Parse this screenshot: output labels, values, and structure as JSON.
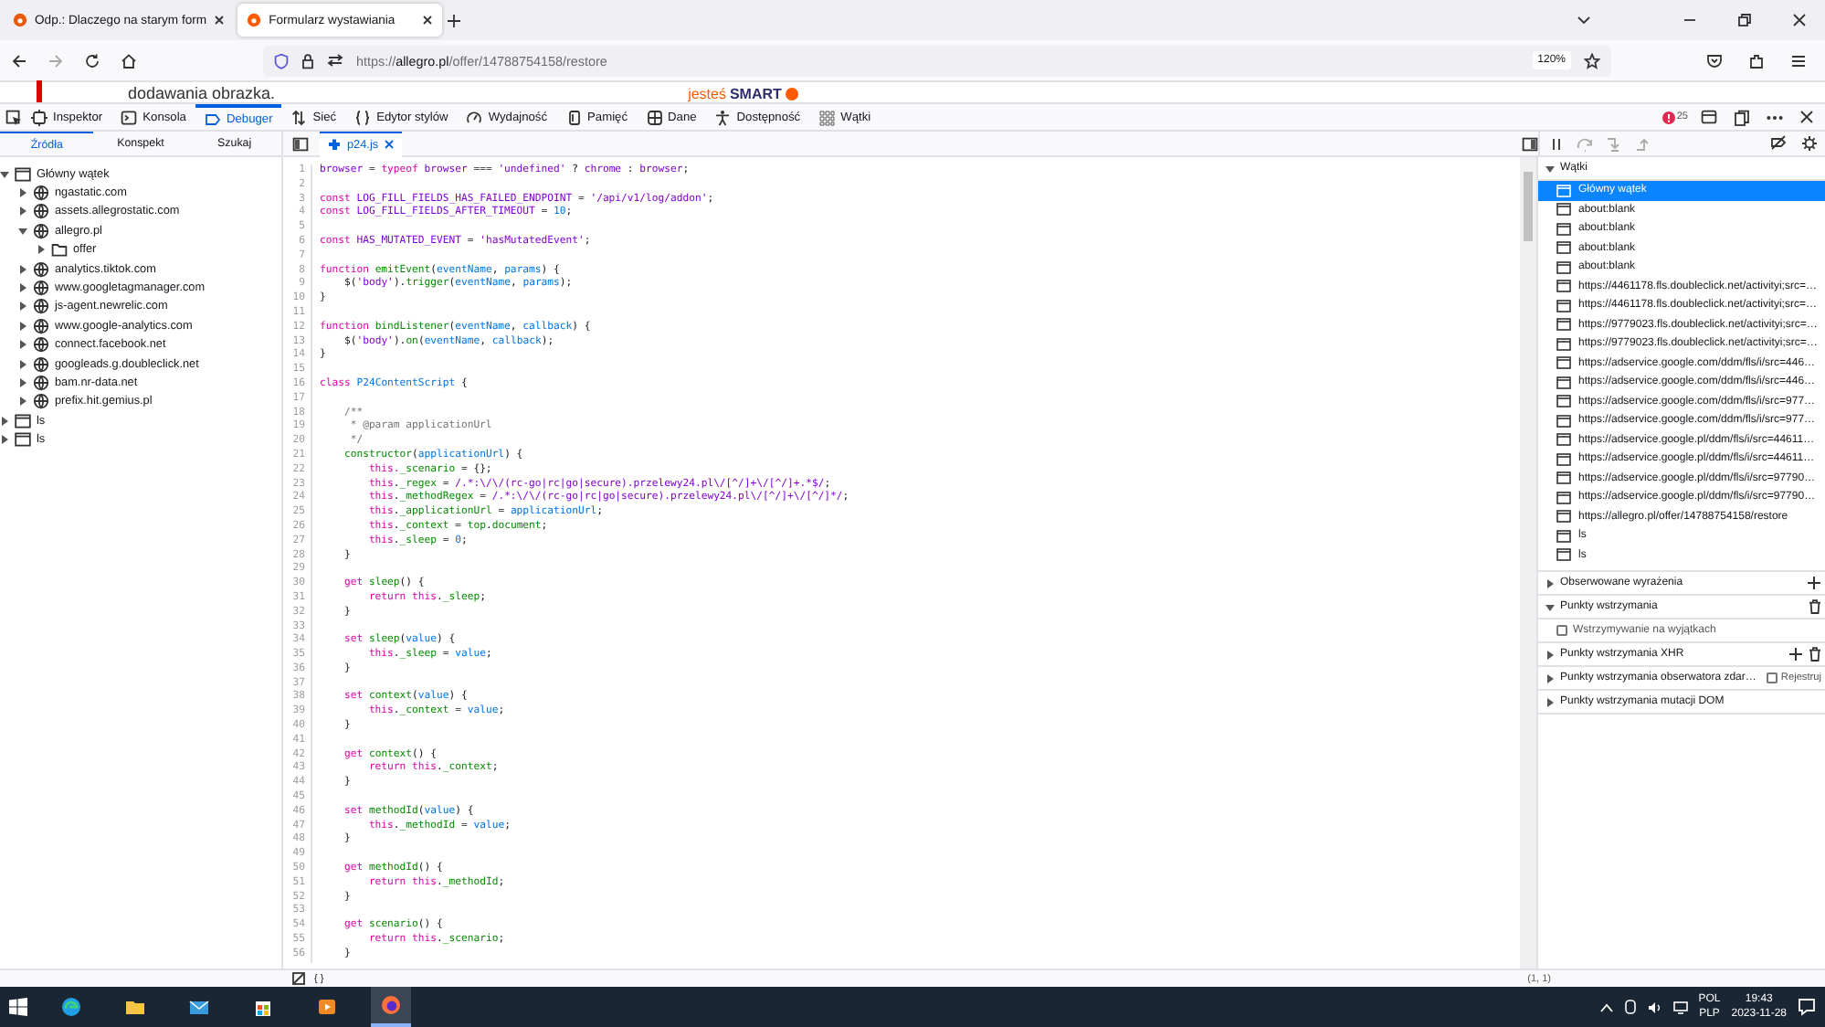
{
  "browser_tabs": [
    {
      "title": "Odp.: Dlaczego na starym form",
      "selected": false
    },
    {
      "title": "Formularz wystawiania",
      "selected": true
    }
  ],
  "address_bar": {
    "url": "https://**allegro.pl**/offer/14788754158/restore",
    "zoom": "120%"
  },
  "page": {
    "text": "dodawania obrazka.",
    "banner_prefix": "jesteś",
    "banner_brand": "SMART"
  },
  "devtools": {
    "tools": [
      {
        "label": "Inspektor",
        "kind": "inspector",
        "selected": false
      },
      {
        "label": "Konsola",
        "kind": "console",
        "selected": false
      },
      {
        "label": "Debuger",
        "kind": "debugger",
        "selected": true
      },
      {
        "label": "Sieć",
        "kind": "network",
        "selected": false
      },
      {
        "label": "Edytor stylów",
        "kind": "style",
        "selected": false
      },
      {
        "label": "Wydajność",
        "kind": "performance",
        "selected": false
      },
      {
        "label": "Pamięć",
        "kind": "memory",
        "selected": false
      },
      {
        "label": "Dane",
        "kind": "storage",
        "selected": false
      },
      {
        "label": "Dostępność",
        "kind": "accessibility",
        "selected": false
      },
      {
        "label": "Wątki",
        "kind": "threads",
        "selected": false
      }
    ],
    "error_count": "25",
    "source_tabs": [
      {
        "label": "Źródła",
        "selected": true
      },
      {
        "label": "Konspekt",
        "selected": false
      },
      {
        "label": "Szukaj",
        "selected": false
      }
    ],
    "editor_tab": {
      "label": "p24.js"
    },
    "source_tree": [
      {
        "label": "Główny wątek",
        "kind": "thread",
        "expanded": true,
        "children": [
          {
            "label": "ngastatic.com",
            "kind": "domain",
            "expanded": false
          },
          {
            "label": "assets.allegrostatic.com",
            "kind": "domain",
            "expanded": false
          },
          {
            "label": "allegro.pl",
            "kind": "domain",
            "expanded": true,
            "children": [
              {
                "label": "offer",
                "kind": "folder",
                "expanded": false
              }
            ]
          },
          {
            "label": "analytics.tiktok.com",
            "kind": "domain",
            "expanded": false
          },
          {
            "label": "www.googletagmanager.com",
            "kind": "domain",
            "expanded": false
          },
          {
            "label": "js-agent.newrelic.com",
            "kind": "domain",
            "expanded": false
          },
          {
            "label": "www.google-analytics.com",
            "kind": "domain",
            "expanded": false
          },
          {
            "label": "connect.facebook.net",
            "kind": "domain",
            "expanded": false
          },
          {
            "label": "googleads.g.doubleclick.net",
            "kind": "domain",
            "expanded": false
          },
          {
            "label": "bam.nr-data.net",
            "kind": "domain",
            "expanded": false
          },
          {
            "label": "prefix.hit.gemius.pl",
            "kind": "domain",
            "expanded": false
          }
        ]
      },
      {
        "label": "ls",
        "kind": "thread",
        "expanded": false
      },
      {
        "label": "ls",
        "kind": "thread",
        "expanded": false
      }
    ],
    "code_lines": [
      {
        "number": "1",
        "code": [
          {
            "kind": "string",
            "text": "browser"
          },
          {
            "kind": "plain",
            "text": " = "
          },
          {
            "kind": "keyword",
            "text": "typeof "
          },
          {
            "kind": "string",
            "text": "browser"
          },
          {
            "kind": "plain",
            "text": " === "
          },
          {
            "kind": "string",
            "text": "'undefined'"
          },
          {
            "kind": "plain",
            "text": " ? "
          },
          {
            "kind": "string",
            "text": "chrome"
          },
          {
            "kind": "plain",
            "text": " : "
          },
          {
            "kind": "string",
            "text": "browser"
          },
          {
            "kind": "plain",
            "text": ";"
          }
        ]
      },
      {
        "number": "2"
      },
      {
        "number": "3",
        "code": [
          {
            "kind": "keyword",
            "text": "const "
          },
          {
            "kind": "string",
            "text": "LOG_FILL_FIELDS_HAS_FAILED_ENDPOINT"
          },
          {
            "kind": "plain",
            "text": " = "
          },
          {
            "kind": "string",
            "text": "'/api/v1/log/addon'"
          },
          {
            "kind": "plain",
            "text": ";"
          }
        ]
      },
      {
        "number": "4",
        "code": [
          {
            "kind": "keyword",
            "text": "const "
          },
          {
            "kind": "string",
            "text": "LOG_FILL_FIELDS_AFTER_TIMEOUT"
          },
          {
            "kind": "plain",
            "text": " = "
          },
          {
            "kind": "variable",
            "text": "10"
          },
          {
            "kind": "plain",
            "text": ";"
          }
        ]
      },
      {
        "number": "5"
      },
      {
        "number": "6",
        "code": [
          {
            "kind": "keyword",
            "text": "const "
          },
          {
            "kind": "string",
            "text": "HAS_MUTATED_EVENT"
          },
          {
            "kind": "plain",
            "text": " = "
          },
          {
            "kind": "string",
            "text": "'hasMutatedEvent'"
          },
          {
            "kind": "plain",
            "text": ";"
          }
        ]
      },
      {
        "number": "7"
      },
      {
        "number": "8",
        "code": [
          {
            "kind": "keyword",
            "text": "function "
          },
          {
            "kind": "name",
            "text": "emitEvent"
          },
          {
            "kind": "plain",
            "text": "("
          },
          {
            "kind": "variable",
            "text": "eventName"
          },
          {
            "kind": "plain",
            "text": ", "
          },
          {
            "kind": "variable",
            "text": "params"
          },
          {
            "kind": "plain",
            "text": ") {"
          }
        ]
      },
      {
        "number": "9",
        "code": [
          {
            "kind": "plain",
            "text": "    $("
          },
          {
            "kind": "string",
            "text": "'body'"
          },
          {
            "kind": "plain",
            "text": ")."
          },
          {
            "kind": "name",
            "text": "trigger"
          },
          {
            "kind": "plain",
            "text": "("
          },
          {
            "kind": "variable",
            "text": "eventName"
          },
          {
            "kind": "plain",
            "text": ", "
          },
          {
            "kind": "variable",
            "text": "params"
          },
          {
            "kind": "plain",
            "text": ");"
          }
        ]
      },
      {
        "number": "10",
        "code": [
          {
            "kind": "plain",
            "text": "}"
          }
        ]
      },
      {
        "number": "11"
      },
      {
        "number": "12",
        "code": [
          {
            "kind": "keyword",
            "text": "function "
          },
          {
            "kind": "name",
            "text": "bindListener"
          },
          {
            "kind": "plain",
            "text": "("
          },
          {
            "kind": "variable",
            "text": "eventName"
          },
          {
            "kind": "plain",
            "text": ", "
          },
          {
            "kind": "variable",
            "text": "callback"
          },
          {
            "kind": "plain",
            "text": ") {"
          }
        ]
      },
      {
        "number": "13",
        "code": [
          {
            "kind": "plain",
            "text": "    $("
          },
          {
            "kind": "string",
            "text": "'body'"
          },
          {
            "kind": "plain",
            "text": ")."
          },
          {
            "kind": "name",
            "text": "on"
          },
          {
            "kind": "plain",
            "text": "("
          },
          {
            "kind": "variable",
            "text": "eventName"
          },
          {
            "kind": "plain",
            "text": ", "
          },
          {
            "kind": "variable",
            "text": "callback"
          },
          {
            "kind": "plain",
            "text": ");"
          }
        ]
      },
      {
        "number": "14",
        "code": [
          {
            "kind": "plain",
            "text": "}"
          }
        ]
      },
      {
        "number": "15"
      },
      {
        "number": "16",
        "code": [
          {
            "kind": "keyword",
            "text": "class "
          },
          {
            "kind": "variable",
            "text": "P24ContentScript"
          },
          {
            "kind": "plain",
            "text": " {"
          }
        ]
      },
      {
        "number": "17"
      },
      {
        "number": "18",
        "code": [
          {
            "kind": "comment",
            "text": "    /**"
          }
        ]
      },
      {
        "number": "19",
        "code": [
          {
            "kind": "comment",
            "text": "     * @param applicationUrl"
          }
        ]
      },
      {
        "number": "20",
        "code": [
          {
            "kind": "comment",
            "text": "     */"
          }
        ]
      },
      {
        "number": "21",
        "code": [
          {
            "kind": "name",
            "text": "    constructor"
          },
          {
            "kind": "plain",
            "text": "("
          },
          {
            "kind": "variable",
            "text": "applicationUrl"
          },
          {
            "kind": "plain",
            "text": ") {"
          }
        ]
      },
      {
        "number": "22",
        "code": [
          {
            "kind": "keyword",
            "text": "        this."
          },
          {
            "kind": "name",
            "text": "_scenario"
          },
          {
            "kind": "plain",
            "text": " = {};"
          }
        ]
      },
      {
        "number": "23",
        "code": [
          {
            "kind": "keyword",
            "text": "        this"
          },
          {
            "kind": "plain",
            "text": "."
          },
          {
            "kind": "name",
            "text": "_regex"
          },
          {
            "kind": "plain",
            "text": " = "
          },
          {
            "kind": "string",
            "text": "/.*:\\/\\/(rc-go|rc|go|secure).przelewy24.pl\\/[^/]+\\/[^/]+.*$/"
          },
          {
            "kind": "plain",
            "text": ";"
          }
        ]
      },
      {
        "number": "24",
        "code": [
          {
            "kind": "keyword",
            "text": "        this"
          },
          {
            "kind": "plain",
            "text": "."
          },
          {
            "kind": "name",
            "text": "_methodRegex"
          },
          {
            "kind": "plain",
            "text": " = "
          },
          {
            "kind": "string",
            "text": "/.*:\\/\\/(rc-go|rc|go|secure).przelewy24.pl\\/[^/]+\\/[^/]*/"
          },
          {
            "kind": "plain",
            "text": ";"
          }
        ]
      },
      {
        "number": "25",
        "code": [
          {
            "kind": "keyword",
            "text": "        this"
          },
          {
            "kind": "plain",
            "text": "."
          },
          {
            "kind": "name",
            "text": "_applicationUrl"
          },
          {
            "kind": "plain",
            "text": " = "
          },
          {
            "kind": "variable",
            "text": "applicationUrl"
          },
          {
            "kind": "plain",
            "text": ";"
          }
        ]
      },
      {
        "number": "26",
        "code": [
          {
            "kind": "keyword",
            "text": "        this"
          },
          {
            "kind": "plain",
            "text": "."
          },
          {
            "kind": "name",
            "text": "_context"
          },
          {
            "kind": "plain",
            "text": " = "
          },
          {
            "kind": "name",
            "text": "top"
          },
          {
            "kind": "plain",
            "text": "."
          },
          {
            "kind": "name",
            "text": "document"
          },
          {
            "kind": "plain",
            "text": ";"
          }
        ]
      },
      {
        "number": "27",
        "code": [
          {
            "kind": "keyword",
            "text": "        this"
          },
          {
            "kind": "plain",
            "text": "."
          },
          {
            "kind": "name",
            "text": "_sleep"
          },
          {
            "kind": "plain",
            "text": " = "
          },
          {
            "kind": "variable",
            "text": "0"
          },
          {
            "kind": "plain",
            "text": ";"
          }
        ]
      },
      {
        "number": "28",
        "code": [
          {
            "kind": "plain",
            "text": "    }"
          }
        ]
      },
      {
        "number": "29"
      },
      {
        "number": "30",
        "code": [
          {
            "kind": "keyword",
            "text": "    get "
          },
          {
            "kind": "name",
            "text": "sleep"
          },
          {
            "kind": "plain",
            "text": "() {"
          }
        ]
      },
      {
        "number": "31",
        "code": [
          {
            "kind": "keyword",
            "text": "        return this"
          },
          {
            "kind": "plain",
            "text": "."
          },
          {
            "kind": "name",
            "text": "_sleep"
          },
          {
            "kind": "plain",
            "text": ";"
          }
        ]
      },
      {
        "number": "32",
        "code": [
          {
            "kind": "plain",
            "text": "    }"
          }
        ]
      },
      {
        "number": "33"
      },
      {
        "number": "34",
        "code": [
          {
            "kind": "keyword",
            "text": "    set "
          },
          {
            "kind": "name",
            "text": "sleep"
          },
          {
            "kind": "plain",
            "text": "("
          },
          {
            "kind": "variable",
            "text": "value"
          },
          {
            "kind": "plain",
            "text": ") {"
          }
        ]
      },
      {
        "number": "35",
        "code": [
          {
            "kind": "keyword",
            "text": "        this"
          },
          {
            "kind": "plain",
            "text": "."
          },
          {
            "kind": "name",
            "text": "_sleep"
          },
          {
            "kind": "plain",
            "text": " = "
          },
          {
            "kind": "variable",
            "text": "value"
          },
          {
            "kind": "plain",
            "text": ";"
          }
        ]
      },
      {
        "number": "36",
        "code": [
          {
            "kind": "plain",
            "text": "    }"
          }
        ]
      },
      {
        "number": "37"
      },
      {
        "number": "38",
        "code": [
          {
            "kind": "keyword",
            "text": "    set "
          },
          {
            "kind": "name",
            "text": "context"
          },
          {
            "kind": "plain",
            "text": "("
          },
          {
            "kind": "variable",
            "text": "value"
          },
          {
            "kind": "plain",
            "text": ") {"
          }
        ]
      },
      {
        "number": "39",
        "code": [
          {
            "kind": "keyword",
            "text": "        this"
          },
          {
            "kind": "plain",
            "text": "."
          },
          {
            "kind": "name",
            "text": "_context"
          },
          {
            "kind": "plain",
            "text": " = "
          },
          {
            "kind": "variable",
            "text": "value"
          },
          {
            "kind": "plain",
            "text": ";"
          }
        ]
      },
      {
        "number": "40",
        "code": [
          {
            "kind": "plain",
            "text": "    }"
          }
        ]
      },
      {
        "number": "41"
      },
      {
        "number": "42",
        "code": [
          {
            "kind": "keyword",
            "text": "    get "
          },
          {
            "kind": "name",
            "text": "context"
          },
          {
            "kind": "plain",
            "text": "() {"
          }
        ]
      },
      {
        "number": "43",
        "code": [
          {
            "kind": "keyword",
            "text": "        return this"
          },
          {
            "kind": "plain",
            "text": "."
          },
          {
            "kind": "name",
            "text": "_context"
          },
          {
            "kind": "plain",
            "text": ";"
          }
        ]
      },
      {
        "number": "44",
        "code": [
          {
            "kind": "plain",
            "text": "    }"
          }
        ]
      },
      {
        "number": "45"
      },
      {
        "number": "46",
        "code": [
          {
            "kind": "keyword",
            "text": "    set "
          },
          {
            "kind": "name",
            "text": "methodId"
          },
          {
            "kind": "plain",
            "text": "("
          },
          {
            "kind": "variable",
            "text": "value"
          },
          {
            "kind": "plain",
            "text": ") {"
          }
        ]
      },
      {
        "number": "47",
        "code": [
          {
            "kind": "keyword",
            "text": "        this"
          },
          {
            "kind": "plain",
            "text": "."
          },
          {
            "kind": "name",
            "text": "_methodId"
          },
          {
            "kind": "plain",
            "text": " = "
          },
          {
            "kind": "variable",
            "text": "value"
          },
          {
            "kind": "plain",
            "text": ";"
          }
        ]
      },
      {
        "number": "48",
        "code": [
          {
            "kind": "plain",
            "text": "    }"
          }
        ]
      },
      {
        "number": "49"
      },
      {
        "number": "50",
        "code": [
          {
            "kind": "keyword",
            "text": "    get "
          },
          {
            "kind": "name",
            "text": "methodId"
          },
          {
            "kind": "plain",
            "text": "() {"
          }
        ]
      },
      {
        "number": "51",
        "code": [
          {
            "kind": "keyword",
            "text": "        return this"
          },
          {
            "kind": "plain",
            "text": "."
          },
          {
            "kind": "name",
            "text": "_methodId"
          },
          {
            "kind": "plain",
            "text": ";"
          }
        ]
      },
      {
        "number": "52",
        "code": [
          {
            "kind": "plain",
            "text": "    }"
          }
        ]
      },
      {
        "number": "53"
      },
      {
        "number": "54",
        "code": [
          {
            "kind": "keyword",
            "text": "    get "
          },
          {
            "kind": "name",
            "text": "scenario"
          },
          {
            "kind": "plain",
            "text": "() {"
          }
        ]
      },
      {
        "number": "55",
        "code": [
          {
            "kind": "keyword",
            "text": "        return this"
          },
          {
            "kind": "plain",
            "text": "."
          },
          {
            "kind": "name",
            "text": "_scenario"
          },
          {
            "kind": "plain",
            "text": ";"
          }
        ]
      },
      {
        "number": "56",
        "code": [
          {
            "kind": "plain",
            "text": "    }"
          }
        ]
      }
    ],
    "panel_sections": [
      {
        "title": "Wątki",
        "expanded": true,
        "items": [
          {
            "label": "Główny wątek",
            "selected": true
          },
          {
            "label": "about:blank",
            "selected": false
          },
          {
            "label": "about:blank",
            "selected": false
          },
          {
            "label": "about:blank",
            "selected": false
          },
          {
            "label": "about:blank",
            "selected": false
          },
          {
            "label": "https://4461178.fls.doubleclick.net/activityi;src=…",
            "selected": false
          },
          {
            "label": "https://4461178.fls.doubleclick.net/activityi;src=…",
            "selected": false
          },
          {
            "label": "https://9779023.fls.doubleclick.net/activityi;src=…",
            "selected": false
          },
          {
            "label": "https://9779023.fls.doubleclick.net/activityi;src=…",
            "selected": false
          },
          {
            "label": "https://adservice.google.com/ddm/fls/i/src=446…",
            "selected": false
          },
          {
            "label": "https://adservice.google.com/ddm/fls/i/src=446…",
            "selected": false
          },
          {
            "label": "https://adservice.google.com/ddm/fls/i/src=977…",
            "selected": false
          },
          {
            "label": "https://adservice.google.com/ddm/fls/i/src=977…",
            "selected": false
          },
          {
            "label": "https://adservice.google.pl/ddm/fls/i/src=44611…",
            "selected": false
          },
          {
            "label": "https://adservice.google.pl/ddm/fls/i/src=44611…",
            "selected": false
          },
          {
            "label": "https://adservice.google.pl/ddm/fls/i/src=97790…",
            "selected": false
          },
          {
            "label": "https://adservice.google.pl/ddm/fls/i/src=97790…",
            "selected": false
          },
          {
            "label": "https://allegro.pl/offer/14788754158/restore",
            "selected": false
          },
          {
            "label": "ls",
            "selected": false
          },
          {
            "label": "ls",
            "selected": false
          }
        ]
      },
      {
        "title": "Obserwowane wyrażenia",
        "expanded": false,
        "add_button": true
      },
      {
        "title": "Punkty wstrzymania",
        "expanded": true,
        "delete_button": true,
        "options": [
          {
            "label": "Wstrzymywanie na wyjątkach",
            "checked": false
          }
        ]
      },
      {
        "title": "Punkty wstrzymania XHR",
        "expanded": false,
        "add_button": true,
        "delete_button": true
      },
      {
        "title": "Punkty wstrzymania obserwatora zdar…",
        "expanded": false,
        "toggle": {
          "label": "Rejestruj",
          "checked": false
        }
      },
      {
        "title": "Punkty wstrzymania mutacji DOM",
        "expanded": false
      }
    ],
    "status_bar": {
      "format_label": "{ }",
      "position": "(1, 1)"
    }
  },
  "taskbar": {
    "language": "POL",
    "layout": "PLP",
    "time": "19:43",
    "date": "2023-11-28"
  }
}
